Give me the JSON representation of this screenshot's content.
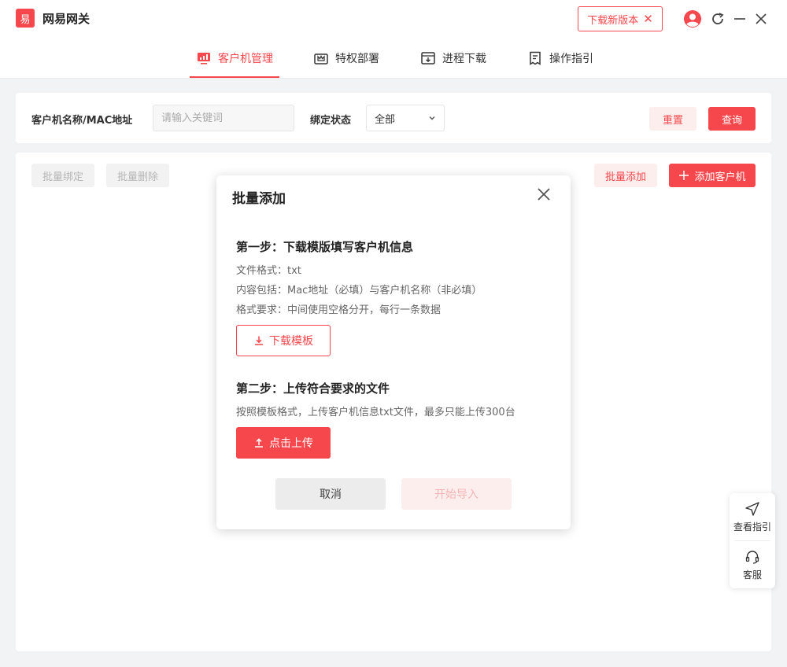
{
  "app": {
    "logo_char": "易",
    "title": "网易网关"
  },
  "titlebar": {
    "update_label": "下载新版本",
    "update_close": "✕"
  },
  "nav": {
    "items": [
      {
        "label": "客户机管理",
        "icon": "monitor-chart-icon",
        "active": true
      },
      {
        "label": "特权部署",
        "icon": "crown-box-icon",
        "active": false
      },
      {
        "label": "进程下载",
        "icon": "download-box-icon",
        "active": false
      },
      {
        "label": "操作指引",
        "icon": "document-icon",
        "active": false
      }
    ]
  },
  "filter": {
    "name_label": "客户机名称/MAC地址",
    "search_placeholder": "请输入关键词",
    "search_value": "",
    "bind_label": "绑定状态",
    "bind_value": "全部",
    "reset_label": "重置",
    "query_label": "查询"
  },
  "toolbar": {
    "batch_bind": "批量绑定",
    "batch_delete": "批量删除",
    "batch_add": "批量添加",
    "add_client": "添加客户机"
  },
  "modal": {
    "title": "批量添加",
    "step1_title": "第一步：下载模版填写客户机信息",
    "step1_lines": [
      "文件格式：txt",
      "内容包括：Mac地址（必填）与客户机名称（非必填）",
      "格式要求：中间使用空格分开，每行一条数据"
    ],
    "download_template": "下载模板",
    "step2_title": "第二步：上传符合要求的文件",
    "step2_line": "按照模板格式，上传客户机信息txt文件，最多只能上传300台",
    "upload_label": "点击上传",
    "cancel_label": "取消",
    "import_label": "开始导入"
  },
  "float_panel": {
    "guide_label": "查看指引",
    "service_label": "客服"
  },
  "colors": {
    "accent": "#f5474c",
    "accent_light": "#fdeeee"
  }
}
